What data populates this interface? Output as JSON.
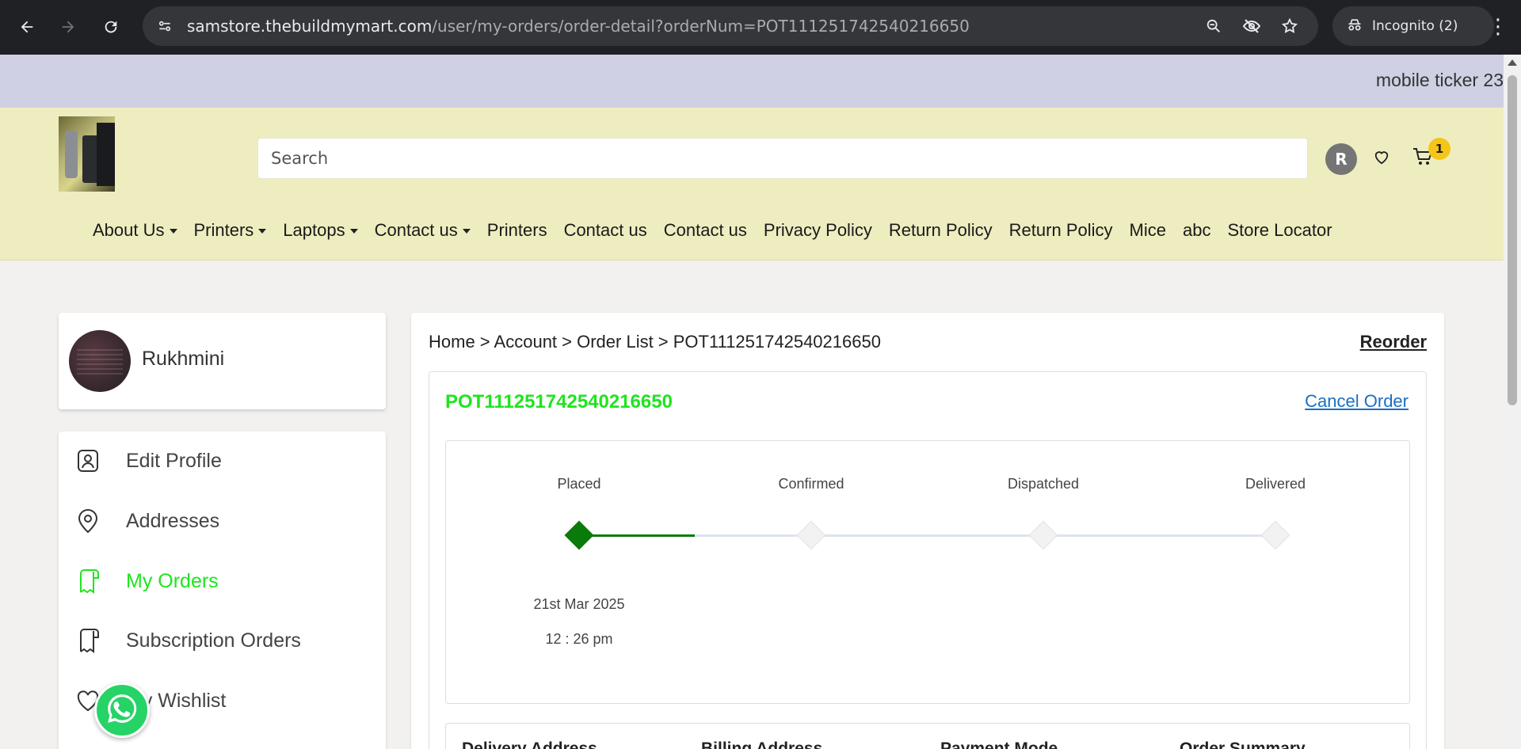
{
  "browser": {
    "url_host": "samstore.thebuildmymart.com",
    "url_path": "/user/my-orders/order-detail?orderNum=POT111251742540216650",
    "incognito_label": "Incognito (2)"
  },
  "ticker": {
    "text": "mobile ticker 23"
  },
  "header": {
    "search_placeholder": "Search",
    "avatar_initial": "R",
    "cart_count": "1",
    "menu": [
      {
        "label": "About Us",
        "dropdown": true
      },
      {
        "label": "Printers",
        "dropdown": true
      },
      {
        "label": "Laptops",
        "dropdown": true
      },
      {
        "label": "Contact us",
        "dropdown": true
      },
      {
        "label": "Printers",
        "dropdown": false
      },
      {
        "label": "Contact us",
        "dropdown": false
      },
      {
        "label": "Contact us",
        "dropdown": false
      },
      {
        "label": "Privacy Policy",
        "dropdown": false
      },
      {
        "label": "Return Policy",
        "dropdown": false
      },
      {
        "label": "Return Policy",
        "dropdown": false
      },
      {
        "label": "Mice",
        "dropdown": false
      },
      {
        "label": "abc",
        "dropdown": false
      },
      {
        "label": "Store Locator",
        "dropdown": false
      }
    ]
  },
  "profile": {
    "name": "Rukhmini"
  },
  "sidebar": {
    "items": [
      {
        "label": "Edit Profile",
        "icon": "user-card-icon",
        "active": false
      },
      {
        "label": "Addresses",
        "icon": "location-pin-icon",
        "active": false
      },
      {
        "label": "My Orders",
        "icon": "receipt-icon",
        "active": true
      },
      {
        "label": "Subscription Orders",
        "icon": "receipt-icon",
        "active": false
      },
      {
        "label": "My Wishlist",
        "icon": "heart-icon",
        "active": false
      }
    ]
  },
  "main": {
    "breadcrumb": "Home > Account > Order List > POT111251742540216650",
    "reorder_label": "Reorder",
    "order_number": "POT111251742540216650",
    "cancel_label": "Cancel Order",
    "steps": [
      {
        "label": "Placed",
        "done": true,
        "date": "21st Mar 2025",
        "time": "12 : 26 pm"
      },
      {
        "label": "Confirmed",
        "done": false,
        "date": "",
        "time": ""
      },
      {
        "label": "Dispatched",
        "done": false,
        "date": "",
        "time": ""
      },
      {
        "label": "Delivered",
        "done": false,
        "date": "",
        "time": ""
      }
    ],
    "info_headings": [
      "Delivery Address",
      "Billing Address",
      "Payment Mode",
      "Order Summary"
    ]
  },
  "colors": {
    "accent_green": "#1ee51e",
    "progress_green": "#0a7a0a",
    "link_blue": "#1a6fc4",
    "header_bg": "#eeedc0",
    "ticker_bg": "#cfd0e3"
  }
}
